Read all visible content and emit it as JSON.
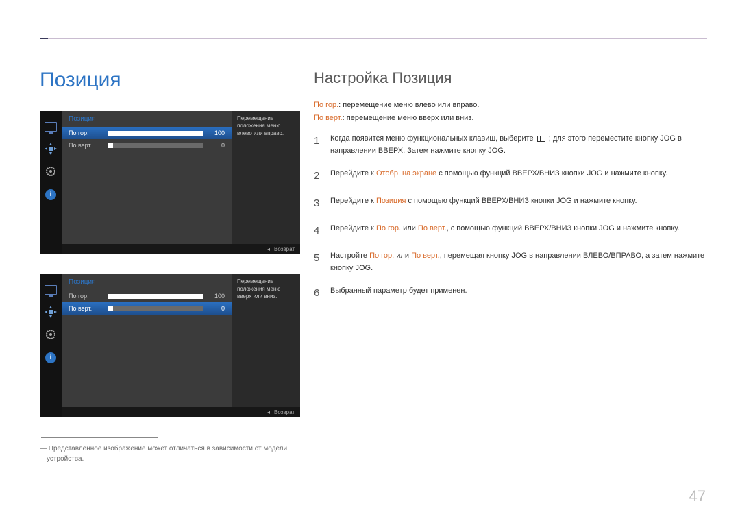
{
  "page_number": "47",
  "main_title": "Позиция",
  "sub_title": "Настройка Позиция",
  "descriptions": {
    "horiz_label": "По гор.",
    "horiz_text": ": перемещение меню влево или вправо.",
    "vert_label": "По верт.",
    "vert_text": ": перемещение меню вверх или вниз."
  },
  "osd": {
    "title": "Позиция",
    "rows": [
      {
        "label": "По гор.",
        "value": "100",
        "fill": "100%"
      },
      {
        "label": "По верт.",
        "value": "0",
        "fill": "5%"
      }
    ],
    "help1": "Перемещение положения меню влево или вправо.",
    "help2": "Перемещение положения меню вверх или вниз.",
    "return": "Возврат"
  },
  "footnote": "― Представленное изображение может отличаться в зависимости от модели устройства.",
  "steps": [
    {
      "num": "1",
      "body": "Когда появится меню функциональных клавиш, выберите {MENU} ; для этого переместите кнопку JOG в направлении ВВЕРХ. Затем нажмите кнопку JOG."
    },
    {
      "num": "2",
      "body": "Перейдите к {ACCENT:Отобр. на экране} с помощью функций ВВЕРХ/ВНИЗ кнопки JOG и нажмите кнопку."
    },
    {
      "num": "3",
      "body": "Перейдите к {ACCENT:Позиция} с помощью функций ВВЕРХ/ВНИЗ кнопки JOG и нажмите кнопку."
    },
    {
      "num": "4",
      "body": "Перейдите к {ACCENT:По гор.} или {ACCENT:По верт.}, с помощью функций ВВЕРХ/ВНИЗ кнопки JOG и нажмите кнопку."
    },
    {
      "num": "5",
      "body": "Настройте {ACCENT:По гор.} или {ACCENT:По верт.}, перемещая кнопку JOG в направлении ВЛЕВО/ВПРАВО, а затем нажмите кнопку JOG."
    },
    {
      "num": "6",
      "body": "Выбранный параметр будет применен."
    }
  ]
}
